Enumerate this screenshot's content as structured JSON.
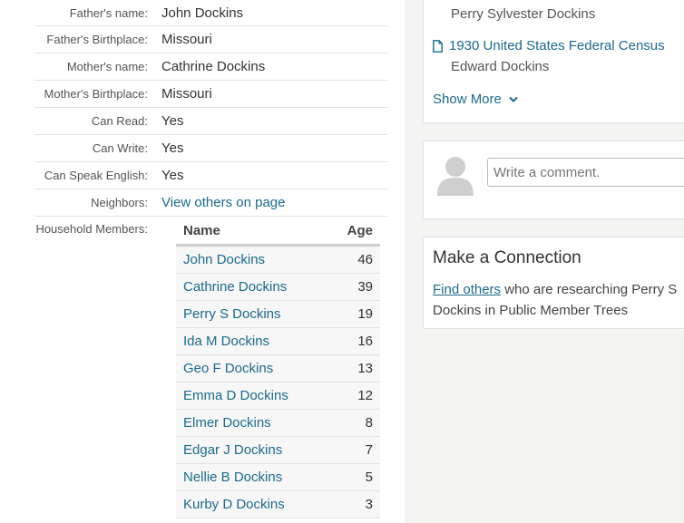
{
  "details": [
    {
      "label": "Father's name:",
      "value": "John Dockins",
      "link": false
    },
    {
      "label": "Father's Birthplace:",
      "value": "Missouri",
      "link": false
    },
    {
      "label": "Mother's name:",
      "value": "Cathrine Dockins",
      "link": false
    },
    {
      "label": "Mother's Birthplace:",
      "value": "Missouri",
      "link": false
    },
    {
      "label": "Can Read:",
      "value": "Yes",
      "link": false
    },
    {
      "label": "Can Write:",
      "value": "Yes",
      "link": false
    },
    {
      "label": "Can Speak English:",
      "value": "Yes",
      "link": false
    },
    {
      "label": "Neighbors:",
      "value": "View others on page",
      "link": true
    }
  ],
  "household": {
    "label": "Household Members:",
    "col_name": "Name",
    "col_age": "Age",
    "members": [
      {
        "name": "John Dockins",
        "age": "46"
      },
      {
        "name": "Cathrine Dockins",
        "age": "39"
      },
      {
        "name": "Perry S Dockins",
        "age": "19"
      },
      {
        "name": "Ida M Dockins",
        "age": "16"
      },
      {
        "name": "Geo F Dockins",
        "age": "13"
      },
      {
        "name": "Emma D Dockins",
        "age": "12"
      },
      {
        "name": "Elmer Dockins",
        "age": "8"
      },
      {
        "name": "Edgar J Dockins",
        "age": "7"
      },
      {
        "name": "Nellie B Dockins",
        "age": "5"
      },
      {
        "name": "Kurby D Dockins",
        "age": "3"
      }
    ]
  },
  "records": {
    "prev_person": "Perry Sylvester Dockins",
    "census_link": "1930 United States Federal Census",
    "census_person": "Edward Dockins",
    "show_more": "Show More"
  },
  "comment": {
    "placeholder": "Write a comment."
  },
  "connection": {
    "title": "Make a Connection",
    "link": "Find others",
    "text": " who are researching Perry S Dockins in Public Member Trees"
  }
}
